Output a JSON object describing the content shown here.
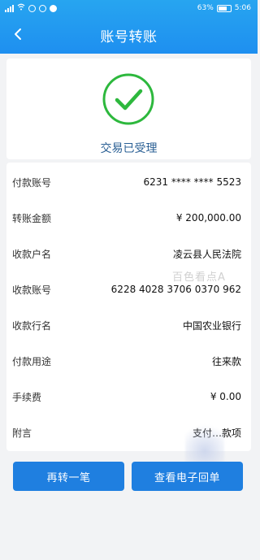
{
  "status_bar": {
    "battery": "63%",
    "time": "5:06"
  },
  "header": {
    "title": "账号转账"
  },
  "result": {
    "status_text": "交易已受理"
  },
  "details": [
    {
      "label": "付款账号",
      "value": "6231 **** **** 5523"
    },
    {
      "label": "转账金额",
      "value": "¥ 200,000.00"
    },
    {
      "label": "收款户名",
      "value": "凌云县人民法院"
    },
    {
      "label": "收款账号",
      "value": "6228 4028 3706 0370 962"
    },
    {
      "label": "收款行名",
      "value": "中国农业银行"
    },
    {
      "label": "付款用途",
      "value": "往来款"
    },
    {
      "label": "手续费",
      "value": "¥ 0.00"
    },
    {
      "label": "附言",
      "value": "支付…款项"
    }
  ],
  "watermark": {
    "text": "百色看点A"
  },
  "actions": {
    "transfer_again": "再转一笔",
    "view_receipt": "查看电子回单"
  },
  "colors": {
    "header_blue": "#1e8ff0",
    "button_blue": "#1f7fe0",
    "success_green": "#2db83d"
  }
}
